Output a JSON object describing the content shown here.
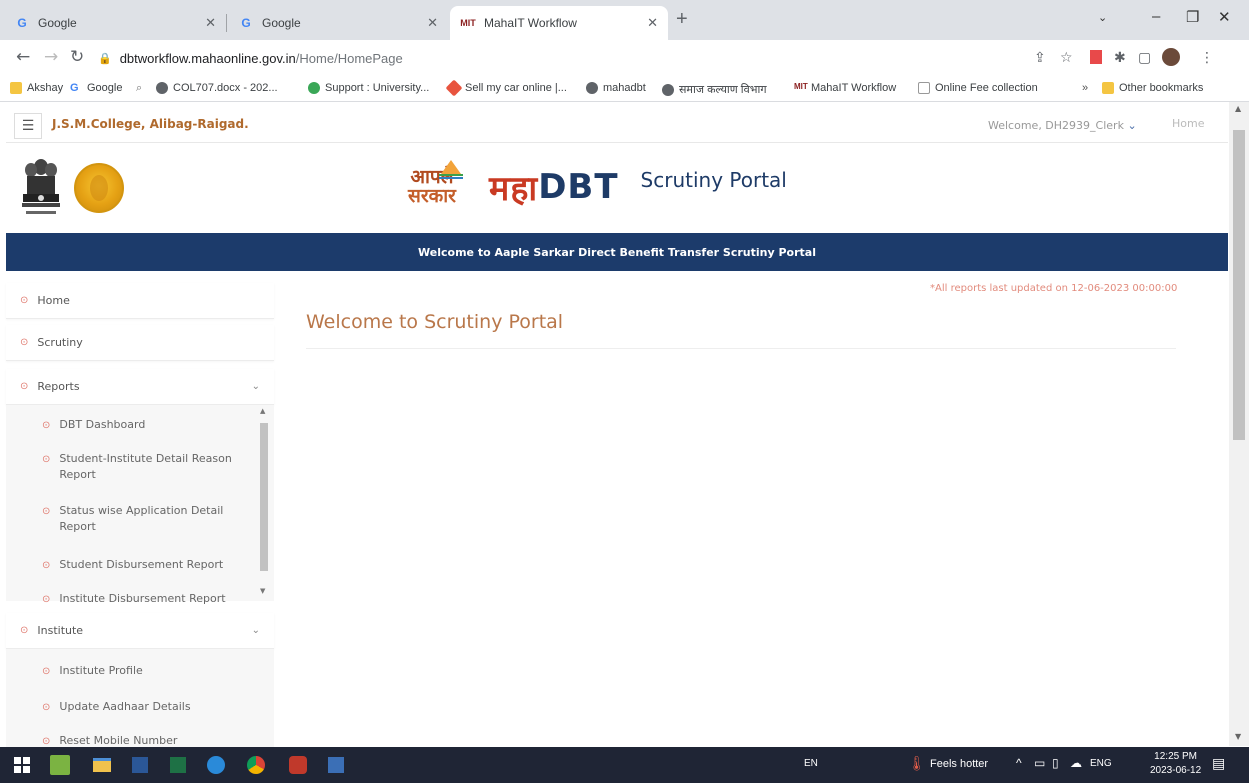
{
  "browser": {
    "tabs": [
      {
        "title": "Google",
        "favicon": "google-g"
      },
      {
        "title": "Google",
        "favicon": "google-g"
      },
      {
        "title": "MahaIT Workflow",
        "favicon": "mahait"
      }
    ],
    "url_domain": "dbtworkflow.mahaonline.gov.in",
    "url_path": "/Home/HomePage",
    "bookmarks": [
      "Akshay",
      "Google",
      "COL707.docx - 202...",
      "Support : University...",
      "Sell my car online |...",
      "mahadbt",
      "समाज कल्याण विभाग",
      "MahaIT Workflow",
      "Online Fee collection",
      "Other bookmarks"
    ],
    "bookmarks_overflow": "»"
  },
  "page": {
    "college_name": "J.S.M.College, Alibag-Raigad.",
    "welcome_user": "Welcome, DH2939_Clerk",
    "home_link": "Home",
    "logo": {
      "aaple_line1": "आपले",
      "aaple_line2": "सरकार",
      "maha": "महा",
      "dbt": "DBT",
      "portal": "Scrutiny Portal"
    },
    "banner": "Welcome to Aaple Sarkar Direct Benefit Transfer Scrutiny Portal",
    "main_title": "Welcome to Scrutiny Portal",
    "updated_note": "*All reports last updated on 12-06-2023 00:00:00"
  },
  "sidebar": {
    "home": "Home",
    "scrutiny": "Scrutiny",
    "reports": "Reports",
    "reports_items": [
      "DBT Dashboard",
      "Student-Institute Detail Reason Report",
      "Status wise Application Detail Report",
      "Student Disbursement Report",
      "Institute Disbursement Report"
    ],
    "institute": "Institute",
    "institute_items": [
      "Institute Profile",
      "Update Aadhaar Details",
      "Reset Mobile Number"
    ]
  },
  "taskbar": {
    "weather": "Feels hotter",
    "input_lang": "EN",
    "lang": "ENG",
    "time": "12:25 PM",
    "date": "2023-06-12"
  },
  "colors": {
    "banner": "#1c3b6b",
    "accent_orange": "#b9774a",
    "bullet": "#e07a6f",
    "taskbar": "#1f2535"
  }
}
